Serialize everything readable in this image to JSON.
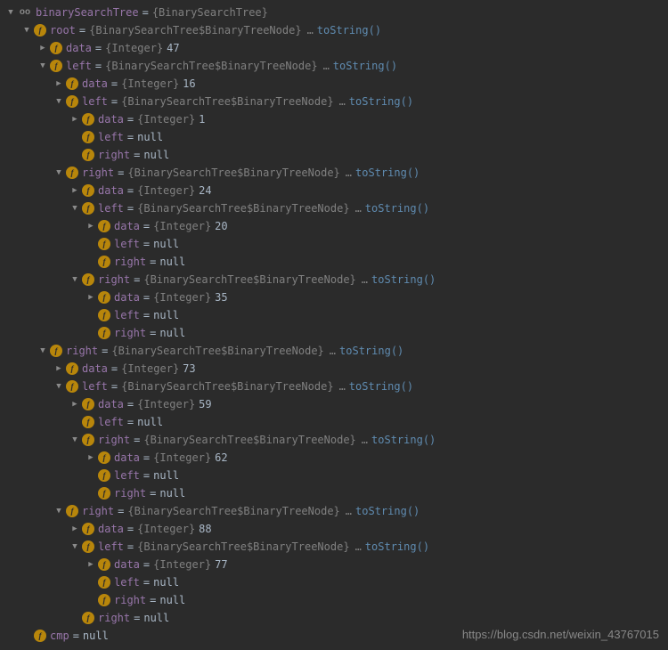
{
  "tokens": {
    "eq": "=",
    "dots": "…",
    "null": "null",
    "toString": "toString()"
  },
  "types": {
    "bst": "{BinarySearchTree}",
    "node": "{BinarySearchTree$BinaryTreeNode}",
    "int": "{Integer}"
  },
  "labels": {
    "binarySearchTree": "binarySearchTree",
    "root": "root",
    "data": "data",
    "left": "left",
    "right": "right",
    "cmp": "cmp"
  },
  "values": {
    "v47": "47",
    "v16": "16",
    "v1": "1",
    "v24": "24",
    "v20": "20",
    "v35": "35",
    "v73": "73",
    "v59": "59",
    "v62": "62",
    "v88": "88",
    "v77": "77"
  },
  "watermark": "https://blog.csdn.net/weixin_43767015",
  "glyphs": {
    "down": "▼",
    "right": "▶",
    "f": "f",
    "oo": "oo"
  }
}
